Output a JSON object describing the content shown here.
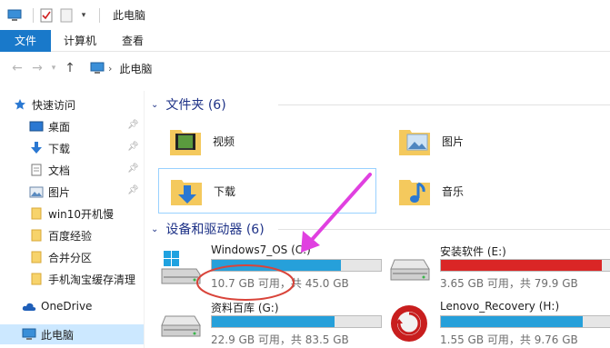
{
  "window": {
    "title": "此电脑"
  },
  "ribbon": {
    "tabs": [
      "文件",
      "计算机",
      "查看"
    ]
  },
  "address": {
    "path": "此电脑"
  },
  "sidebar": {
    "quick_access": "快速访问",
    "items": [
      {
        "label": "桌面",
        "icon": "desktop-icon",
        "pinned": true
      },
      {
        "label": "下载",
        "icon": "download-icon",
        "pinned": true
      },
      {
        "label": "文档",
        "icon": "document-icon",
        "pinned": true
      },
      {
        "label": "图片",
        "icon": "picture-icon",
        "pinned": true
      },
      {
        "label": "win10开机慢",
        "icon": "folder-icon",
        "pinned": false
      },
      {
        "label": "百度经验",
        "icon": "folder-icon",
        "pinned": false
      },
      {
        "label": "合并分区",
        "icon": "folder-icon",
        "pinned": false
      },
      {
        "label": "手机淘宝缓存清理",
        "icon": "folder-icon",
        "pinned": false
      }
    ],
    "onedrive": "OneDrive",
    "this_pc": "此电脑"
  },
  "folders_group": {
    "title": "文件夹 (6)",
    "items": [
      {
        "label": "视频",
        "icon": "video-folder-icon"
      },
      {
        "label": "图片",
        "icon": "picture-folder-icon"
      },
      {
        "label": "下载",
        "icon": "download-folder-icon"
      },
      {
        "label": "音乐",
        "icon": "music-folder-icon"
      }
    ]
  },
  "drives_group": {
    "title": "设备和驱动器 (6)",
    "drives": [
      {
        "name": "Windows7_OS (C:)",
        "info": "10.7 GB 可用，共 45.0 GB",
        "used_fraction": 0.762,
        "color": "#26a0da"
      },
      {
        "name": "安装软件 (E:)",
        "info": "3.65 GB 可用，共 79.9 GB",
        "used_fraction": 0.954,
        "color": "#da2626"
      },
      {
        "name": "资料百库 (G:)",
        "info": "22.9 GB 可用，共 83.5 GB",
        "used_fraction": 0.726,
        "color": "#26a0da"
      },
      {
        "name": "Lenovo_Recovery (H:)",
        "info": "1.55 GB 可用，共 9.76 GB",
        "used_fraction": 0.841,
        "color": "#26a0da"
      }
    ]
  },
  "colors": {
    "accent": "#1979ca",
    "drive_bar": "#26a0da",
    "drive_bar_full": "#da2626",
    "annotation": "#e040e0",
    "annotation_circle": "#d9443a"
  }
}
